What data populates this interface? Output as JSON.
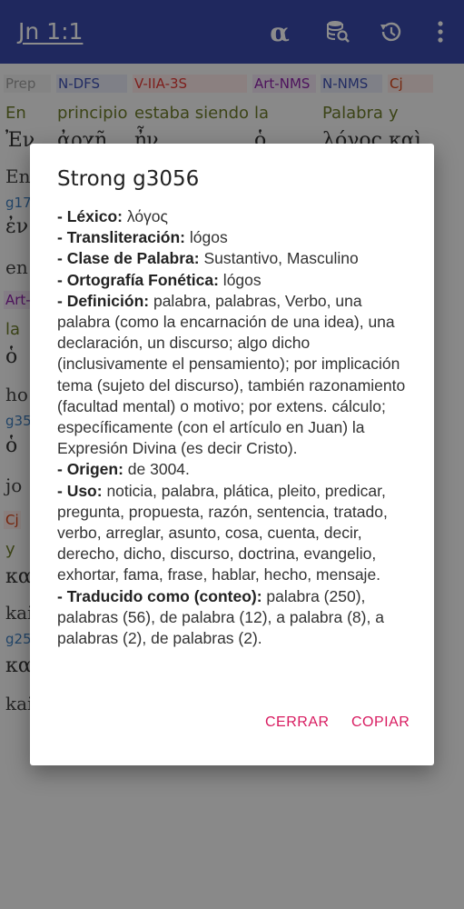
{
  "appbar": {
    "title": "Jn 1:1",
    "icons": [
      "alpha-icon",
      "database-search-icon",
      "history-icon",
      "more-vert-icon"
    ],
    "alpha_symbol": "α"
  },
  "background": {
    "tags": [
      "Prep",
      "N-DFS",
      "V-IIA-3S",
      "Art-NMS",
      "N-NMS",
      "Cj"
    ],
    "glosses": [
      "En",
      "principio",
      "estaba siendo",
      "la",
      "Palabra",
      "y"
    ],
    "greek_row1": [
      "Ἐν",
      "ἀρχῇ",
      "ἦν",
      "ὁ",
      "λόγος",
      "καὶ"
    ],
    "left_column": [
      "En",
      "g17",
      "ἐν",
      "en",
      "Art-",
      "la",
      "ὁ",
      "ho",
      "g35",
      "ὁ",
      "jo",
      "Cj",
      "y",
      "κα",
      "kai",
      "g25",
      "κα",
      "kai"
    ]
  },
  "dialog": {
    "title": "Strong g3056",
    "fields": [
      {
        "label": "- Léxico:",
        "value": " λόγος"
      },
      {
        "label": "- Transliteración:",
        "value": " lógos"
      },
      {
        "label": "- Clase de Palabra:",
        "value": " Sustantivo, Masculino"
      },
      {
        "label": "- Ortografía Fonética:",
        "value": " lógos"
      },
      {
        "label": "- Definición:",
        "value": " palabra, palabras, Verbo, una palabra (como la encarnación de una idea), una declaración, un discurso; algo dicho (inclusivamente el pensamiento); por implicación tema (sujeto del discurso), también razonamiento (facultad mental) o motivo; por extens. cálculo; específicamente (con el artículo en Juan) la Expresión Divina (es decir Cristo)."
      },
      {
        "label": "- Origen:",
        "value": " de 3004."
      },
      {
        "label": "- Uso:",
        "value": " noticia, palabra, plática, pleito, predicar, pregunta, propuesta, razón, sentencia, tratado, verbo, arreglar, asunto, cosa, cuenta, decir, derecho, dicho, discurso, doctrina, evangelio, exhortar, fama, frase, hablar, hecho, mensaje."
      },
      {
        "label": "- Traducido como (conteo):",
        "value": " palabra (250), palabras (56), de palabra (12), a palabra (8), a palabras (2), de palabras (2)."
      }
    ],
    "close_label": "CERRAR",
    "copy_label": "COPIAR"
  },
  "colors": {
    "appbar": "#3949ab",
    "accent": "#d81b60"
  }
}
